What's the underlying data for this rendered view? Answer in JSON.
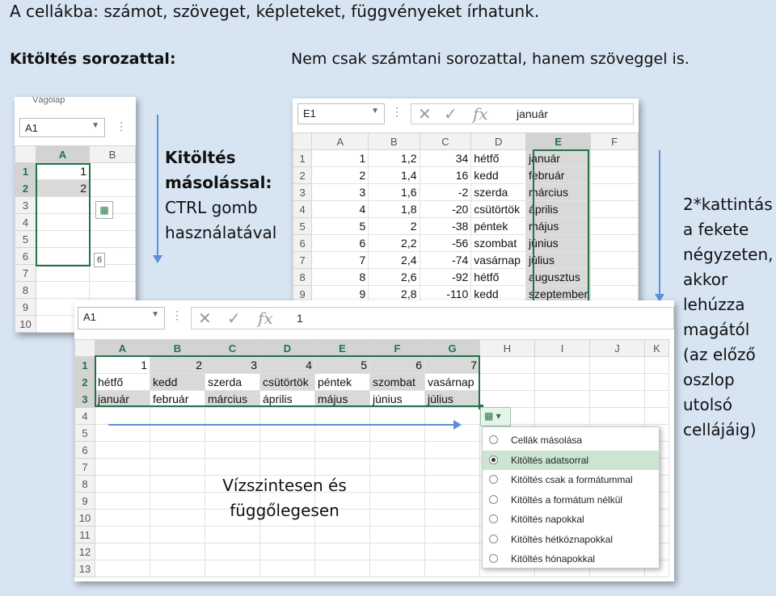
{
  "texts": {
    "title": "A cellákba: számot, szöveget, képleteket, függvényeket írhatunk.",
    "fill_series": "Kitöltés sorozattal:",
    "not_only": "Nem csak számtani sorozattal, hanem szöveggel is.",
    "copy_fill_l1": "Kitöltés",
    "copy_fill_l2": "másolással:",
    "copy_fill_l3": "CTRL gomb",
    "copy_fill_l4": "használatával",
    "dbl_l1": "2*kattintás",
    "dbl_l2": "a fekete",
    "dbl_l3": "négyzeten,",
    "dbl_l4": "akkor",
    "dbl_l5": "lehúzza",
    "dbl_l6": "magától",
    "dbl_l7": "(az előző",
    "dbl_l8": "oszlop",
    "dbl_l9": "utolsó",
    "dbl_l10": "cellájáig)",
    "hv_l1": "Vízszintesen és",
    "hv_l2": "függőlegesen"
  },
  "win1": {
    "ribbon_label": "Vágólap",
    "namebox": "A1",
    "cols": [
      "A",
      "B"
    ],
    "rows": [
      "1",
      "2",
      "3",
      "4",
      "5",
      "6",
      "7",
      "8",
      "9",
      "10"
    ],
    "a1": "1",
    "a2": "2",
    "tooltip": "6"
  },
  "win2": {
    "namebox": "E1",
    "formula": "január",
    "cols": [
      "A",
      "B",
      "C",
      "D",
      "E",
      "F"
    ],
    "rows": [
      [
        "1",
        "1",
        "1,2",
        "34",
        "hétfő",
        "január"
      ],
      [
        "2",
        "2",
        "1,4",
        "16",
        "kedd",
        "február"
      ],
      [
        "3",
        "3",
        "1,6",
        "-2",
        "szerda",
        "március"
      ],
      [
        "4",
        "4",
        "1,8",
        "-20",
        "csütörtök",
        "április"
      ],
      [
        "5",
        "5",
        "2",
        "-38",
        "péntek",
        "május"
      ],
      [
        "6",
        "6",
        "2,2",
        "-56",
        "szombat",
        "június"
      ],
      [
        "7",
        "7",
        "2,4",
        "-74",
        "vasárnap",
        "július"
      ],
      [
        "8",
        "8",
        "2,6",
        "-92",
        "hétfő",
        "augusztus"
      ],
      [
        "9",
        "9",
        "2,8",
        "-110",
        "kedd",
        "szeptember"
      ]
    ]
  },
  "win3": {
    "namebox": "A1",
    "formula": "1",
    "cols": [
      "A",
      "B",
      "C",
      "D",
      "E",
      "F",
      "G",
      "H",
      "I",
      "J",
      "K"
    ],
    "row1": [
      "1",
      "2",
      "3",
      "4",
      "5",
      "6",
      "7"
    ],
    "row2": [
      "hétfő",
      "kedd",
      "szerda",
      "csütörtök",
      "péntek",
      "szombat",
      "vasárnap"
    ],
    "row3": [
      "január",
      "február",
      "március",
      "április",
      "május",
      "június",
      "július"
    ],
    "rownums": [
      "1",
      "2",
      "3",
      "4",
      "5",
      "6",
      "7",
      "8",
      "9",
      "10",
      "11",
      "12",
      "13"
    ]
  },
  "menu": {
    "items": [
      "Cellák másolása",
      "Kitöltés adatsorral",
      "Kitöltés csak a formátummal",
      "Kitöltés a formátum nélkül",
      "Kitöltés napokkal",
      "Kitöltés hétköznapokkal",
      "Kitöltés hónapokkal"
    ],
    "selected_index": 1
  },
  "colors": {
    "excel_green": "#217346",
    "arrow_blue": "#5b8fd6"
  }
}
